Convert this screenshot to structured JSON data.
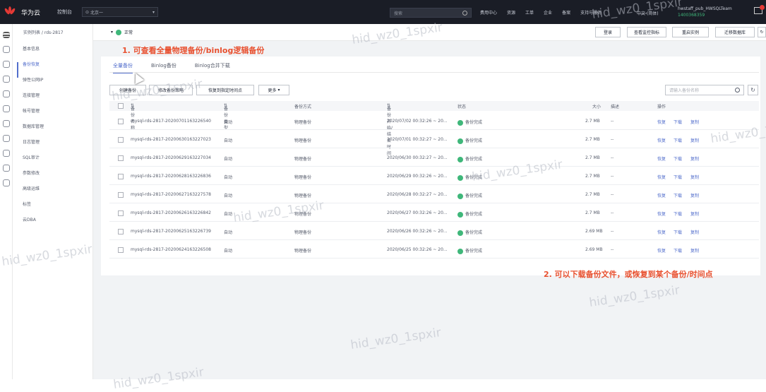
{
  "topbar": {
    "brand": "华为云",
    "console": "控制台",
    "region": "北京一",
    "search_placeholder": "搜索",
    "nav": [
      "费用中心",
      "资源",
      "工单",
      "企业",
      "备案",
      "支持与服务"
    ],
    "lang": "中文 (简体)",
    "user": "hwstaff_pub_HWSQLTeam",
    "user_id": "1400368359"
  },
  "breadcrumb": {
    "parent": "实例列表 /",
    "current": "rds-2817"
  },
  "instance": {
    "status": "正常"
  },
  "header_buttons": [
    "登录",
    "查看监控指标",
    "重启实例",
    "迁移数据库"
  ],
  "subnav": {
    "items": [
      "基本信息",
      "备份恢复",
      "弹性公网IP",
      "连接管理",
      "帐号管理",
      "数据库管理",
      "日志管理",
      "SQL审计",
      "参数修改",
      "高级运维",
      "标签",
      "云DBA"
    ],
    "active_index": 1
  },
  "tabs": [
    "全量备份",
    "Binlog备份",
    "Binlog合并下载"
  ],
  "toolbar": {
    "buttons": [
      "创建备份",
      "修改备份策略",
      "恢复到指定时间点",
      "更多"
    ],
    "search_placeholder": "请输入备份名称"
  },
  "table": {
    "headers": [
      "备份名称",
      "备份类型",
      "备份方式",
      "备份开始/结束时间",
      "状态",
      "大小",
      "描述",
      "操作"
    ],
    "rows": [
      {
        "name": "mysql-rds-2817-20200701163226540",
        "type": "自动",
        "method": "物理备份",
        "time": "2020/07/02 00:32:26 ~ 20...",
        "status": "备份完成",
        "size": "2.7 MB",
        "desc": "--"
      },
      {
        "name": "mysql-rds-2817-20200630163227023",
        "type": "自动",
        "method": "物理备份",
        "time": "2020/07/01 00:32:27 ~ 20...",
        "status": "备份完成",
        "size": "2.7 MB",
        "desc": "--"
      },
      {
        "name": "mysql-rds-2817-20200629163227034",
        "type": "自动",
        "method": "物理备份",
        "time": "2020/06/30 00:32:27 ~ 20...",
        "status": "备份完成",
        "size": "2.7 MB",
        "desc": "--"
      },
      {
        "name": "mysql-rds-2817-20200628163226836",
        "type": "自动",
        "method": "物理备份",
        "time": "2020/06/29 00:32:26 ~ 20...",
        "status": "备份完成",
        "size": "2.7 MB",
        "desc": "--"
      },
      {
        "name": "mysql-rds-2817-20200627163227578",
        "type": "自动",
        "method": "物理备份",
        "time": "2020/06/28 00:32:27 ~ 20...",
        "status": "备份完成",
        "size": "2.7 MB",
        "desc": "--"
      },
      {
        "name": "mysql-rds-2817-20200626163226842",
        "type": "自动",
        "method": "物理备份",
        "time": "2020/06/27 00:32:26 ~ 20...",
        "status": "备份完成",
        "size": "2.7 MB",
        "desc": "--"
      },
      {
        "name": "mysql-rds-2817-20200625163226739",
        "type": "自动",
        "method": "物理备份",
        "time": "2020/06/26 00:32:26 ~ 20...",
        "status": "备份完成",
        "size": "2.69 MB",
        "desc": "--"
      },
      {
        "name": "mysql-rds-2817-20200624163226508",
        "type": "自动",
        "method": "物理备份",
        "time": "2020/06/25 00:32:26 ~ 20...",
        "status": "备份完成",
        "size": "2.69 MB",
        "desc": "--"
      }
    ],
    "actions": [
      "恢复",
      "下载",
      "复制"
    ]
  },
  "annotations": {
    "first": "1. 可查看全量物理备份/binlog逻辑备份",
    "second": "2. 可以下载备份文件，或恢复到某个备份/时间点"
  },
  "watermark": "hid_wz0_1spxir"
}
